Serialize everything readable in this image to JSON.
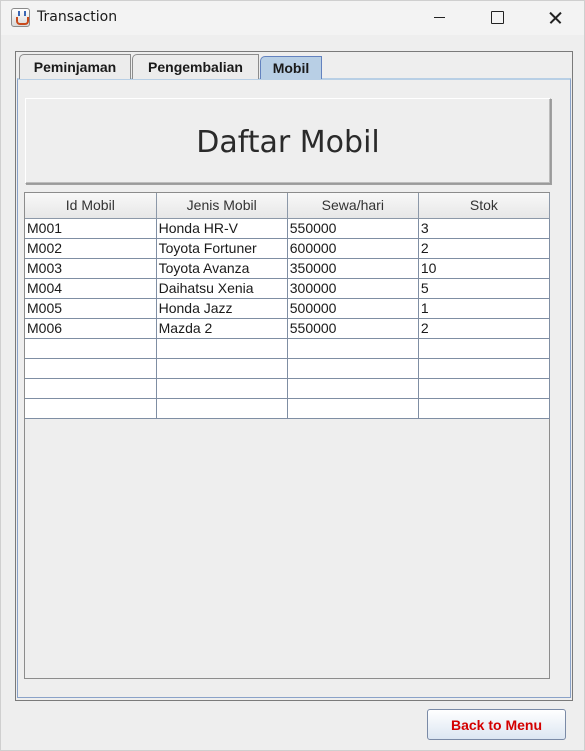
{
  "window": {
    "title": "Transaction"
  },
  "tabs": [
    {
      "label": "Peminjaman"
    },
    {
      "label": "Pengembalian"
    },
    {
      "label": "Mobil",
      "selected": true
    }
  ],
  "panel": {
    "title": "Daftar Mobil"
  },
  "table": {
    "headers": [
      "Id Mobil",
      "Jenis Mobil",
      "Sewa/hari",
      "Stok"
    ],
    "rows": [
      [
        "M001",
        "Honda HR-V",
        "550000",
        "3"
      ],
      [
        "M002",
        "Toyota Fortuner",
        "600000",
        "2"
      ],
      [
        "M003",
        "Toyota Avanza",
        "350000",
        "10"
      ],
      [
        "M004",
        "Daihatsu Xenia",
        "300000",
        "5"
      ],
      [
        "M005",
        "Honda Jazz",
        "500000",
        "1"
      ],
      [
        "M006",
        "Mazda 2",
        "550000",
        "2"
      ],
      [
        "",
        "",
        "",
        ""
      ],
      [
        "",
        "",
        "",
        ""
      ],
      [
        "",
        "",
        "",
        ""
      ],
      [
        "",
        "",
        "",
        ""
      ]
    ]
  },
  "footer": {
    "back_label": "Back to Menu"
  },
  "colors": {
    "selected_tab": "#b8cfe5",
    "back_text": "#d40000"
  }
}
